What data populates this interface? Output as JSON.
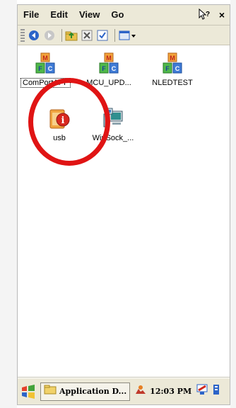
{
  "menubar": {
    "items": [
      "File",
      "Edit",
      "View",
      "Go"
    ],
    "help_icon": "help-cursor-icon",
    "close_label": "×"
  },
  "toolbar": {
    "icons": [
      "back-icon",
      "forward-icon",
      "up-folder-icon",
      "delete-icon",
      "properties-icon",
      "view-menu-icon"
    ]
  },
  "desktop": {
    "items": [
      {
        "label": "ComPortAPP",
        "icon": "mfc-app-icon",
        "selected": true
      },
      {
        "label": "MCU_UPD...",
        "icon": "mfc-app-icon"
      },
      {
        "label": "NLEDTEST",
        "icon": "mfc-app-icon"
      },
      {
        "label": "usb",
        "icon": "usb-info-icon"
      },
      {
        "label": "WinSock_...",
        "icon": "network-computer-icon"
      }
    ]
  },
  "taskbar": {
    "start_icon": "windows-flag-icon",
    "task_button_label": "Application D...",
    "clock": "12:03 PM"
  },
  "colors": {
    "chrome": "#ece9d8",
    "highlight_circle": "#e01414"
  }
}
